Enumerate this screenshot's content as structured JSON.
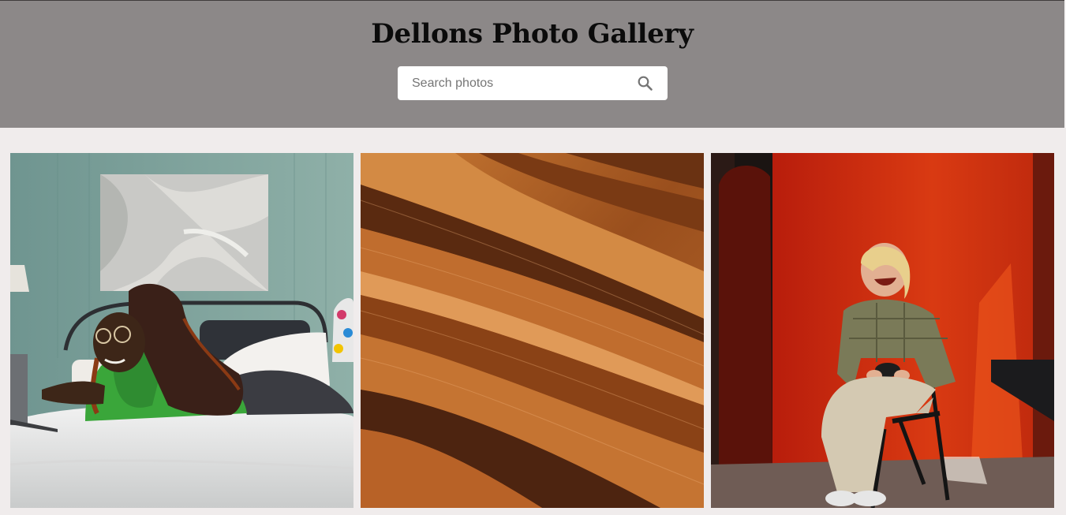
{
  "header": {
    "title": "Dellons Photo Gallery",
    "background": "#8c8888"
  },
  "search": {
    "placeholder": "Search photos",
    "value": "",
    "icon": "search-icon"
  },
  "gallery": {
    "photos": [
      {
        "subject": "woman on bed with laptop"
      },
      {
        "subject": "brown wavy sandstone texture"
      },
      {
        "subject": "laughing woman on chair against red wall"
      }
    ]
  }
}
